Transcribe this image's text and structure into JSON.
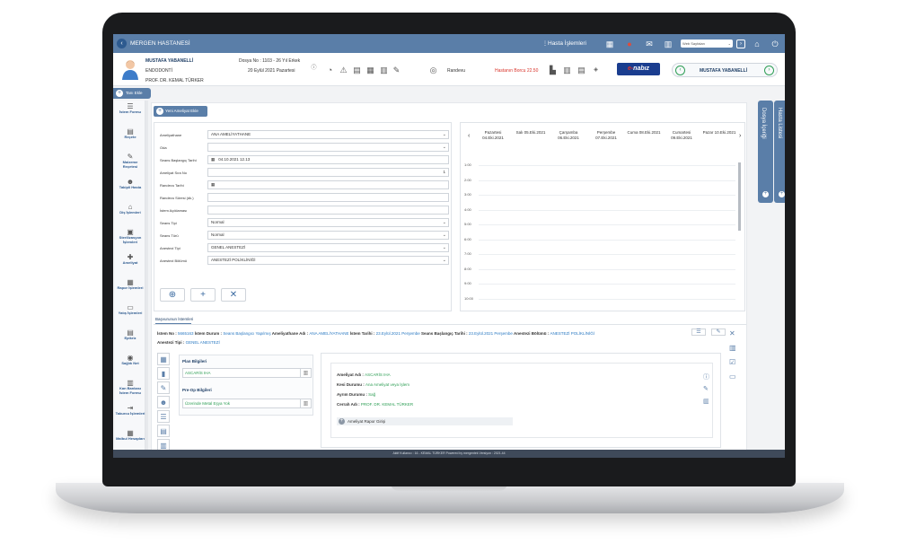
{
  "app": {
    "hospital": "MERGEN HASTANESİ",
    "menu": "Hasta İşlemleri",
    "search_select": "Web Sayfaları"
  },
  "patient": {
    "name": "MUSTAFA YABANELLİ",
    "dept": "ENDODONTİ",
    "doctor": "PROF. DR. KEMAL TÜRKER",
    "dosya": "Dosya No : 1103 - 26 Yıl Erkek",
    "date": "20 Eylül 2021 Pazartesi",
    "randevu": "Randevu",
    "borc": "Hastanın Borcu 22.50"
  },
  "nabiz": {
    "e": "e-",
    "rest": "nabız"
  },
  "tani": "Tanı Ekle",
  "nav": [
    {
      "label": "İstem Formu",
      "icon": "☰"
    },
    {
      "label": "Reçete",
      "icon": "▤"
    },
    {
      "label": "Malzeme Reçetesi",
      "icon": "✎"
    },
    {
      "label": "Takipli Hasta",
      "icon": "☻"
    },
    {
      "label": "Diş İşlemleri",
      "icon": "⌂"
    },
    {
      "label": "Sterilizasyon İşlemleri",
      "icon": "▣"
    },
    {
      "label": "Ameliyat",
      "icon": "✚"
    },
    {
      "label": "Rapor İşlemleri",
      "icon": "▦"
    },
    {
      "label": "Yatış İşlemleri",
      "icon": "▭"
    },
    {
      "label": "Epikriz",
      "icon": "▤"
    },
    {
      "label": "Sağlık Net",
      "icon": "◉"
    },
    {
      "label": "Kan Bankası İstem Formu",
      "icon": "▥"
    },
    {
      "label": "Taburcu İşlemleri",
      "icon": "⇥"
    },
    {
      "label": "Malbul Hesapları",
      "icon": "▦"
    }
  ],
  "form": {
    "new_button": "Yeni Ameliyat Ekle",
    "fields": [
      {
        "label": "Ameliyathane",
        "value": "ANA AMELİYATHANE",
        "select": true
      },
      {
        "label": "Oda",
        "value": "",
        "select": true
      },
      {
        "label": "Seans Başlangıç Tarihi",
        "value": "04.10.2021 12.13",
        "select": false,
        "cal": true
      },
      {
        "label": "Ameliyat Sıra No",
        "value": "1",
        "select": false,
        "right": true
      },
      {
        "label": "Randevu Tarihi",
        "value": "",
        "select": false,
        "cal": true
      },
      {
        "label": "Randevu Süresi (dk.)",
        "value": "",
        "select": false
      },
      {
        "label": "İstem Açıklaması",
        "value": "",
        "select": false
      },
      {
        "label": "Seans Tipi",
        "value": "Normal",
        "select": true
      },
      {
        "label": "Seans Türü",
        "value": "Normal",
        "select": true
      },
      {
        "label": "Anestezi Tipi",
        "value": "GENEL ANESTEZİ",
        "select": true
      },
      {
        "label": "Anestezi Bölümü",
        "value": "ANESTEZİ POLİKLİNİĞİ",
        "select": true
      }
    ]
  },
  "calendar": {
    "days": [
      {
        "d": "Pazartesi",
        "t": "04.Eki.2021"
      },
      {
        "d": "Salı 05.Eki.2021",
        "t": ""
      },
      {
        "d": "Çarşamba",
        "t": "06.Eki.2021"
      },
      {
        "d": "Perşembe",
        "t": "07.Eki.2021"
      },
      {
        "d": "Cuma 08.Eki.2021",
        "t": ""
      },
      {
        "d": "Cumartesi",
        "t": "09.Eki.2021"
      },
      {
        "d": "Pazar 10.Eki.2021",
        "t": ""
      }
    ],
    "hours": [
      "1:00",
      "2:00",
      "3:00",
      "4:00",
      "5:00",
      "6:00",
      "7:00",
      "8:00",
      "9:00",
      "10:00"
    ]
  },
  "tab": "Başvurunun İstemleri",
  "info": {
    "l1": [
      {
        "k": "İstem No : ",
        "v": "5665163"
      },
      {
        "k": " İstem Durum : ",
        "v": "Seans Başlangıcı Yapılmış"
      },
      {
        "k": " Ameliyathane Adı : ",
        "v": "ANA AMELİYATHANE"
      },
      {
        "k": " İstem Tarihi : ",
        "v": "23.Eylül.2021 Perşembe"
      },
      {
        "k": " Seans Başlangıç Tarihi : ",
        "v": "23.Eylül.2021 Perşembe"
      },
      {
        "k": " Anestezi Bölümü : ",
        "v": "ANESTEZİ POLİKLİNİĞİ"
      }
    ],
    "l2": [
      {
        "k": "Anestezi Tipi : ",
        "v": "GENEL ANESTEZİ"
      }
    ]
  },
  "plan": {
    "h1": "Plan Bilgileri",
    "v1": "ASCARİS IHA",
    "h2": "Pre-Op Bilgileri",
    "v2": "Üzerinde Metal Eşya Yok"
  },
  "amel": {
    "rows": [
      {
        "k": "Ameliyat Adı : ",
        "v": "ASCARİS IHA"
      },
      {
        "k": "Kesi Durumu : ",
        "v": "Ana Ameliyat veya İşlem"
      },
      {
        "k": "Ayrım Durumu : ",
        "v": "Sağ"
      },
      {
        "k": "Cerrah Adı : ",
        "v": "PROF. DR. KEMAL TÜRKER"
      }
    ],
    "rapor": "Ameliyat Rapor Girişi"
  },
  "vtabs": {
    "dosya": "Dosya İçeriği",
    "hasta": "Hasta Listesi"
  },
  "footer": "Aktif Kullanıcı : 16 - KEMAL TÜRKER    Powered by  mergentek   Versiyon : 2021.44"
}
